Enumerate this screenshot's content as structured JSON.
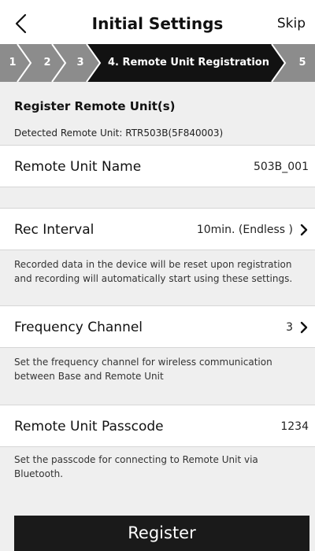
{
  "header": {
    "title": "Initial Settings",
    "skip_label": "Skip"
  },
  "stepper": {
    "steps": [
      {
        "label": "1"
      },
      {
        "label": "2"
      },
      {
        "label": "3"
      },
      {
        "label": "4. Remote Unit Registration"
      },
      {
        "label": "5"
      }
    ],
    "active_step": 4,
    "colors": {
      "inactive": "#8c8c8c",
      "active": "#121212",
      "separator": "#ffffff"
    }
  },
  "section": {
    "title": "Register Remote Unit(s)",
    "detected_text": "Detected Remote Unit: RTR503B(5F840003)"
  },
  "settings": {
    "remote_unit_name": {
      "label": "Remote Unit Name",
      "value": "503B_001"
    },
    "rec_interval": {
      "label": "Rec Interval",
      "value": "10min. (Endless )",
      "note": "Recorded data in the device will be reset upon registration and recording will automatically start using these settings."
    },
    "frequency_channel": {
      "label": "Frequency Channel",
      "value": "3",
      "note": "Set the frequency channel for wireless communication between Base and Remote Unit"
    },
    "passcode": {
      "label": "Remote Unit Passcode",
      "value": "1234",
      "note": "Set the passcode for connecting to Remote Unit via Bluetooth."
    }
  },
  "register_label": "Register"
}
